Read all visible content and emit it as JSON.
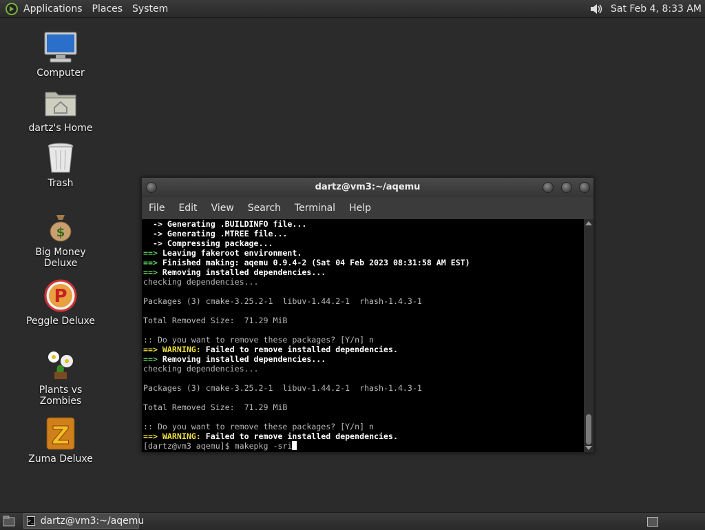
{
  "top_panel": {
    "menus": [
      "Applications",
      "Places",
      "System"
    ],
    "clock": "Sat Feb  4,  8:33 AM"
  },
  "desktop_icons": [
    {
      "label": "Computer",
      "icon": "computer-icon"
    },
    {
      "label": "dartz's Home",
      "icon": "home-folder-icon"
    },
    {
      "label": "Trash",
      "icon": "trash-icon"
    },
    {
      "label": "Big Money Deluxe",
      "icon": "money-bag-icon"
    },
    {
      "label": "Peggle Deluxe",
      "icon": "peggle-icon"
    },
    {
      "label": "Plants vs Zombies",
      "icon": "plants-icon"
    },
    {
      "label": "Zuma Deluxe",
      "icon": "zuma-icon"
    }
  ],
  "terminal": {
    "title": "dartz@vm3:~/aqemu",
    "menus": [
      "File",
      "Edit",
      "View",
      "Search",
      "Terminal",
      "Help"
    ],
    "lines": [
      {
        "segments": [
          {
            "t": "  -> Generating .BUILDINFO file...",
            "c": "w"
          }
        ]
      },
      {
        "segments": [
          {
            "t": "  -> Generating .MTREE file...",
            "c": "w"
          }
        ]
      },
      {
        "segments": [
          {
            "t": "  -> Compressing package...",
            "c": "w"
          }
        ]
      },
      {
        "segments": [
          {
            "t": "==> ",
            "c": "g"
          },
          {
            "t": "Leaving fakeroot environment.",
            "c": "w"
          }
        ]
      },
      {
        "segments": [
          {
            "t": "==> ",
            "c": "g"
          },
          {
            "t": "Finished making: aqemu 0.9.4-2 (Sat 04 Feb 2023 08:31:58 AM EST)",
            "c": "w"
          }
        ]
      },
      {
        "segments": [
          {
            "t": "==> ",
            "c": "g"
          },
          {
            "t": "Removing installed dependencies...",
            "c": "w"
          }
        ]
      },
      {
        "segments": [
          {
            "t": "checking dependencies...",
            "c": "n"
          }
        ]
      },
      {
        "segments": [
          {
            "t": "",
            "c": "n"
          }
        ]
      },
      {
        "segments": [
          {
            "t": "Packages (3) cmake-3.25.2-1  libuv-1.44.2-1  rhash-1.4.3-1",
            "c": "n"
          }
        ]
      },
      {
        "segments": [
          {
            "t": "",
            "c": "n"
          }
        ]
      },
      {
        "segments": [
          {
            "t": "Total Removed Size:  71.29 MiB",
            "c": "n"
          }
        ]
      },
      {
        "segments": [
          {
            "t": "",
            "c": "n"
          }
        ]
      },
      {
        "segments": [
          {
            "t": ":: Do you want to remove these packages? [Y/n] n",
            "c": "n"
          }
        ]
      },
      {
        "segments": [
          {
            "t": "==> ",
            "c": "y"
          },
          {
            "t": "WARNING: ",
            "c": "y"
          },
          {
            "t": "Failed to remove installed dependencies.",
            "c": "w"
          }
        ]
      },
      {
        "segments": [
          {
            "t": "==> ",
            "c": "g"
          },
          {
            "t": "Removing installed dependencies...",
            "c": "w"
          }
        ]
      },
      {
        "segments": [
          {
            "t": "checking dependencies...",
            "c": "n"
          }
        ]
      },
      {
        "segments": [
          {
            "t": "",
            "c": "n"
          }
        ]
      },
      {
        "segments": [
          {
            "t": "Packages (3) cmake-3.25.2-1  libuv-1.44.2-1  rhash-1.4.3-1",
            "c": "n"
          }
        ]
      },
      {
        "segments": [
          {
            "t": "",
            "c": "n"
          }
        ]
      },
      {
        "segments": [
          {
            "t": "Total Removed Size:  71.29 MiB",
            "c": "n"
          }
        ]
      },
      {
        "segments": [
          {
            "t": "",
            "c": "n"
          }
        ]
      },
      {
        "segments": [
          {
            "t": ":: Do you want to remove these packages? [Y/n] n",
            "c": "n"
          }
        ]
      },
      {
        "segments": [
          {
            "t": "==> ",
            "c": "y"
          },
          {
            "t": "WARNING: ",
            "c": "y"
          },
          {
            "t": "Failed to remove installed dependencies.",
            "c": "w"
          }
        ]
      }
    ],
    "prompt": "[dartz@vm3 aqemu]$ ",
    "command": "makepkg -sri"
  },
  "taskbar": {
    "tasks": [
      {
        "label": "dartz@vm3:~/aqemu",
        "icon": "terminal-icon"
      }
    ]
  },
  "colors": {
    "desktop_bg": "#2b2b2b",
    "terminal_bg": "#000000",
    "arrow_green": "#5fd35f",
    "warning_yellow": "#f0e040"
  }
}
